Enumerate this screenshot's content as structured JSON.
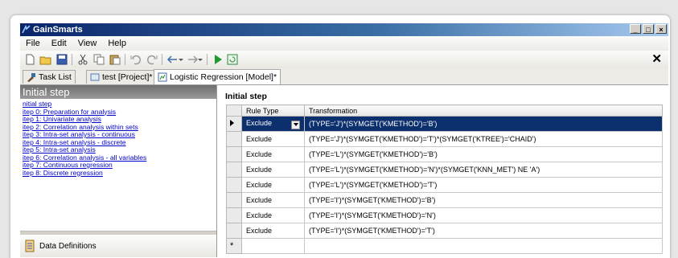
{
  "window": {
    "title": "GainSmarts"
  },
  "menu": [
    "File",
    "Edit",
    "View",
    "Help"
  ],
  "tabs": [
    {
      "label": "Task List",
      "icon": "task-list-icon"
    },
    {
      "label": "test [Project]*",
      "icon": "project-icon"
    },
    {
      "label": "Logistic Regression [Model]*",
      "icon": "model-icon",
      "active": true
    }
  ],
  "left_panel": {
    "header": "Initial step",
    "steps": [
      "nitial step",
      "itep 0: Preparation for analysis",
      "itep 1: Univariate analysis",
      "itep 2: Correlation analysis within sets",
      "itep 3: Intra-set analysis - continuous",
      "itep 4: Intra-set analysis - discrete",
      "itep 5: Intra-set analysis",
      "itep 6: Correlation analysis - all variables",
      "itep 7: Continuous regression",
      "itep 8: Discrete regression"
    ],
    "bottom_item": "Data Definitions"
  },
  "right_panel": {
    "title": "Initial step",
    "columns": [
      "Rule Type",
      "Transformation"
    ],
    "rows": [
      {
        "rule": "Exclude",
        "transformation": "(TYPE='J')*(SYMGET('KMETHOD')='B')",
        "selected": true
      },
      {
        "rule": "Exclude",
        "transformation": "(TYPE='J')*(SYMGET('KMETHOD')='T')*(SYMGET('KTREE')='CHAID')"
      },
      {
        "rule": "Exclude",
        "transformation": "(TYPE='L')*(SYMGET('KMETHOD')='B')"
      },
      {
        "rule": "Exclude",
        "transformation": "(TYPE='L')*(SYMGET('KMETHOD')='N')*(SYMGET('KNN_MET') NE 'A')"
      },
      {
        "rule": "Exclude",
        "transformation": "(TYPE='L')*(SYMGET('KMETHOD')='T')"
      },
      {
        "rule": "Exclude",
        "transformation": "(TYPE='I')*(SYMGET('KMETHOD')='B')"
      },
      {
        "rule": "Exclude",
        "transformation": "(TYPE='I')*(SYMGET('KMETHOD')='N')"
      },
      {
        "rule": "Exclude",
        "transformation": "(TYPE='I')*(SYMGET('KMETHOD')='T')"
      }
    ],
    "new_row_marker": "*"
  },
  "colors": {
    "selection": "#0c2f6d",
    "link": "#0000cc",
    "titlebar": "#0a246a"
  }
}
